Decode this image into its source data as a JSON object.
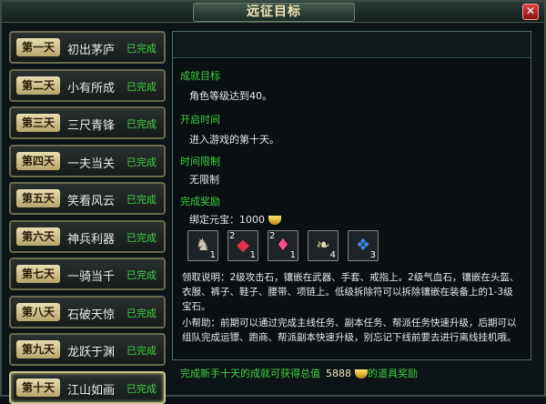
{
  "window": {
    "title": "远征目标",
    "close_label": "✕"
  },
  "days": [
    {
      "badge": "第一天",
      "name": "初出茅庐",
      "status": "已完成"
    },
    {
      "badge": "第二天",
      "name": "小有所成",
      "status": "已完成"
    },
    {
      "badge": "第三天",
      "name": "三尺青锋",
      "status": "已完成"
    },
    {
      "badge": "第四天",
      "name": "一夫当关",
      "status": "已完成"
    },
    {
      "badge": "第五天",
      "name": "笑看风云",
      "status": "已完成"
    },
    {
      "badge": "第六天",
      "name": "神兵利器",
      "status": "已完成"
    },
    {
      "badge": "第七天",
      "name": "一骑当千",
      "status": "已完成"
    },
    {
      "badge": "第八天",
      "name": "石破天惊",
      "status": "已完成"
    },
    {
      "badge": "第九天",
      "name": "龙跃于渊",
      "status": "已完成"
    },
    {
      "badge": "第十天",
      "name": "江山如画",
      "status": "已完成"
    }
  ],
  "panel": {
    "goal_label": "成就目标",
    "goal_text": "角色等级达到40。",
    "open_label": "开启时间",
    "open_text": "进入游戏的第十天。",
    "limit_label": "时间限制",
    "limit_text": "无限制",
    "reward_label": "完成奖励",
    "bound_yuanbao": "绑定元宝：1000",
    "items": [
      {
        "icon": "horse-icon",
        "level": "",
        "qty": "1"
      },
      {
        "icon": "attack-gem-icon",
        "level": "2",
        "qty": "1"
      },
      {
        "icon": "blood-gem-icon",
        "level": "2",
        "qty": "1"
      },
      {
        "icon": "scroll-icon",
        "level": "",
        "qty": "4"
      },
      {
        "icon": "bag-icon",
        "level": "",
        "qty": "3"
      }
    ],
    "collect_desc": "领取说明：2级攻击石，镶嵌在武器、手套、戒指上。2级气血石，镶嵌在头盔、衣服、裤子、鞋子、腰带、项链上。低级拆除符可以拆除镶嵌在装备上的1-3级宝石。",
    "help_desc": "小帮助：前期可以通过完成主线任务、副本任务、帮派任务快速升级，后期可以组队完成运镖、跑商、帮派副本快速升级，别忘记下线前要去进行离线挂机哦。"
  },
  "footer": {
    "text": "完成新手十天的成就可获得总值",
    "total": "5888",
    "suffix": "的道具奖励"
  },
  "colors": {
    "green": "#3fd23f",
    "gold": "#f2e6b2"
  }
}
